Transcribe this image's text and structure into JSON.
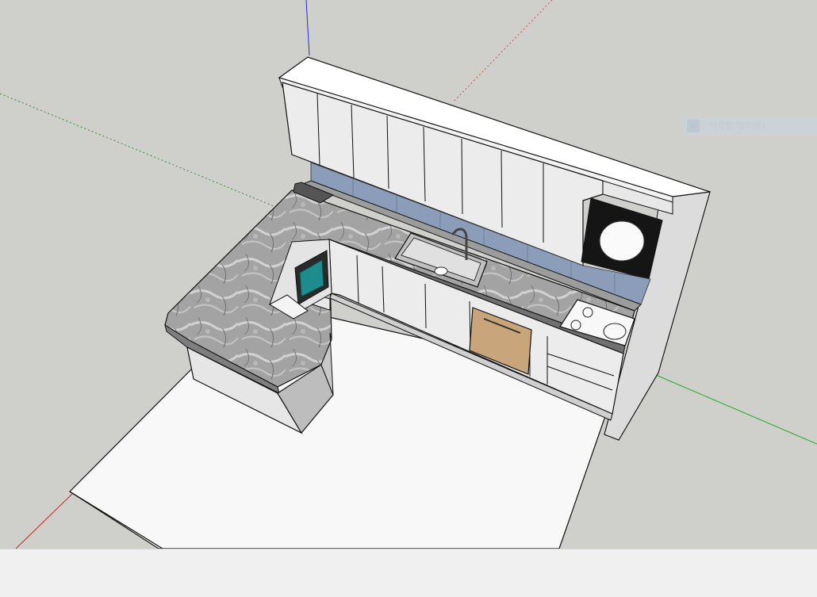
{
  "app": {
    "type": "3d-modeling-viewport",
    "background_color": "#cfd0cb",
    "status_bar_color": "#f0f0f0"
  },
  "viewport": {
    "axis_colors": {
      "red": "#cc2222",
      "green": "#22aa22",
      "blue": "#2222cc"
    },
    "model": "u-shaped-kitchen"
  },
  "tooltip": {
    "label": "사각형 캡처(R)",
    "icon": "rectangle-capture-icon"
  },
  "colors": {
    "floor": "#f8f8f8",
    "cabinet": "#ececec",
    "countertop": "#9a9a9a",
    "backsplash": "#8b9db8",
    "dishwasher": "#c8a57a",
    "hood": "#1a1a1a",
    "microwave_screen": "#1e8c8c"
  },
  "status_bar": {}
}
